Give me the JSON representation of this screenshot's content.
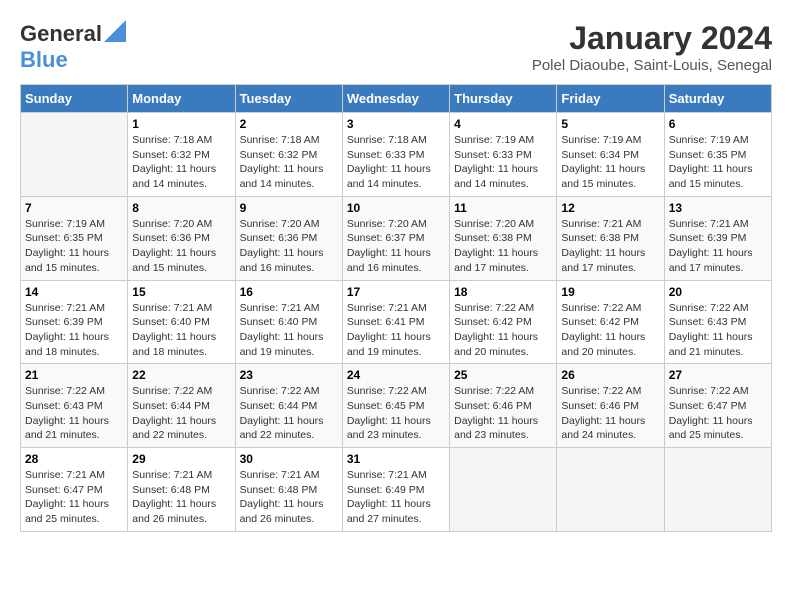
{
  "logo": {
    "general": "General",
    "blue": "Blue"
  },
  "title": "January 2024",
  "subtitle": "Polel Diaoube, Saint-Louis, Senegal",
  "weekdays": [
    "Sunday",
    "Monday",
    "Tuesday",
    "Wednesday",
    "Thursday",
    "Friday",
    "Saturday"
  ],
  "weeks": [
    [
      {
        "day": "",
        "sunrise": "",
        "sunset": "",
        "daylight": ""
      },
      {
        "day": "1",
        "sunrise": "Sunrise: 7:18 AM",
        "sunset": "Sunset: 6:32 PM",
        "daylight": "Daylight: 11 hours and 14 minutes."
      },
      {
        "day": "2",
        "sunrise": "Sunrise: 7:18 AM",
        "sunset": "Sunset: 6:32 PM",
        "daylight": "Daylight: 11 hours and 14 minutes."
      },
      {
        "day": "3",
        "sunrise": "Sunrise: 7:18 AM",
        "sunset": "Sunset: 6:33 PM",
        "daylight": "Daylight: 11 hours and 14 minutes."
      },
      {
        "day": "4",
        "sunrise": "Sunrise: 7:19 AM",
        "sunset": "Sunset: 6:33 PM",
        "daylight": "Daylight: 11 hours and 14 minutes."
      },
      {
        "day": "5",
        "sunrise": "Sunrise: 7:19 AM",
        "sunset": "Sunset: 6:34 PM",
        "daylight": "Daylight: 11 hours and 15 minutes."
      },
      {
        "day": "6",
        "sunrise": "Sunrise: 7:19 AM",
        "sunset": "Sunset: 6:35 PM",
        "daylight": "Daylight: 11 hours and 15 minutes."
      }
    ],
    [
      {
        "day": "7",
        "sunrise": "Sunrise: 7:19 AM",
        "sunset": "Sunset: 6:35 PM",
        "daylight": "Daylight: 11 hours and 15 minutes."
      },
      {
        "day": "8",
        "sunrise": "Sunrise: 7:20 AM",
        "sunset": "Sunset: 6:36 PM",
        "daylight": "Daylight: 11 hours and 15 minutes."
      },
      {
        "day": "9",
        "sunrise": "Sunrise: 7:20 AM",
        "sunset": "Sunset: 6:36 PM",
        "daylight": "Daylight: 11 hours and 16 minutes."
      },
      {
        "day": "10",
        "sunrise": "Sunrise: 7:20 AM",
        "sunset": "Sunset: 6:37 PM",
        "daylight": "Daylight: 11 hours and 16 minutes."
      },
      {
        "day": "11",
        "sunrise": "Sunrise: 7:20 AM",
        "sunset": "Sunset: 6:38 PM",
        "daylight": "Daylight: 11 hours and 17 minutes."
      },
      {
        "day": "12",
        "sunrise": "Sunrise: 7:21 AM",
        "sunset": "Sunset: 6:38 PM",
        "daylight": "Daylight: 11 hours and 17 minutes."
      },
      {
        "day": "13",
        "sunrise": "Sunrise: 7:21 AM",
        "sunset": "Sunset: 6:39 PM",
        "daylight": "Daylight: 11 hours and 17 minutes."
      }
    ],
    [
      {
        "day": "14",
        "sunrise": "Sunrise: 7:21 AM",
        "sunset": "Sunset: 6:39 PM",
        "daylight": "Daylight: 11 hours and 18 minutes."
      },
      {
        "day": "15",
        "sunrise": "Sunrise: 7:21 AM",
        "sunset": "Sunset: 6:40 PM",
        "daylight": "Daylight: 11 hours and 18 minutes."
      },
      {
        "day": "16",
        "sunrise": "Sunrise: 7:21 AM",
        "sunset": "Sunset: 6:40 PM",
        "daylight": "Daylight: 11 hours and 19 minutes."
      },
      {
        "day": "17",
        "sunrise": "Sunrise: 7:21 AM",
        "sunset": "Sunset: 6:41 PM",
        "daylight": "Daylight: 11 hours and 19 minutes."
      },
      {
        "day": "18",
        "sunrise": "Sunrise: 7:22 AM",
        "sunset": "Sunset: 6:42 PM",
        "daylight": "Daylight: 11 hours and 20 minutes."
      },
      {
        "day": "19",
        "sunrise": "Sunrise: 7:22 AM",
        "sunset": "Sunset: 6:42 PM",
        "daylight": "Daylight: 11 hours and 20 minutes."
      },
      {
        "day": "20",
        "sunrise": "Sunrise: 7:22 AM",
        "sunset": "Sunset: 6:43 PM",
        "daylight": "Daylight: 11 hours and 21 minutes."
      }
    ],
    [
      {
        "day": "21",
        "sunrise": "Sunrise: 7:22 AM",
        "sunset": "Sunset: 6:43 PM",
        "daylight": "Daylight: 11 hours and 21 minutes."
      },
      {
        "day": "22",
        "sunrise": "Sunrise: 7:22 AM",
        "sunset": "Sunset: 6:44 PM",
        "daylight": "Daylight: 11 hours and 22 minutes."
      },
      {
        "day": "23",
        "sunrise": "Sunrise: 7:22 AM",
        "sunset": "Sunset: 6:44 PM",
        "daylight": "Daylight: 11 hours and 22 minutes."
      },
      {
        "day": "24",
        "sunrise": "Sunrise: 7:22 AM",
        "sunset": "Sunset: 6:45 PM",
        "daylight": "Daylight: 11 hours and 23 minutes."
      },
      {
        "day": "25",
        "sunrise": "Sunrise: 7:22 AM",
        "sunset": "Sunset: 6:46 PM",
        "daylight": "Daylight: 11 hours and 23 minutes."
      },
      {
        "day": "26",
        "sunrise": "Sunrise: 7:22 AM",
        "sunset": "Sunset: 6:46 PM",
        "daylight": "Daylight: 11 hours and 24 minutes."
      },
      {
        "day": "27",
        "sunrise": "Sunrise: 7:22 AM",
        "sunset": "Sunset: 6:47 PM",
        "daylight": "Daylight: 11 hours and 25 minutes."
      }
    ],
    [
      {
        "day": "28",
        "sunrise": "Sunrise: 7:21 AM",
        "sunset": "Sunset: 6:47 PM",
        "daylight": "Daylight: 11 hours and 25 minutes."
      },
      {
        "day": "29",
        "sunrise": "Sunrise: 7:21 AM",
        "sunset": "Sunset: 6:48 PM",
        "daylight": "Daylight: 11 hours and 26 minutes."
      },
      {
        "day": "30",
        "sunrise": "Sunrise: 7:21 AM",
        "sunset": "Sunset: 6:48 PM",
        "daylight": "Daylight: 11 hours and 26 minutes."
      },
      {
        "day": "31",
        "sunrise": "Sunrise: 7:21 AM",
        "sunset": "Sunset: 6:49 PM",
        "daylight": "Daylight: 11 hours and 27 minutes."
      },
      {
        "day": "",
        "sunrise": "",
        "sunset": "",
        "daylight": ""
      },
      {
        "day": "",
        "sunrise": "",
        "sunset": "",
        "daylight": ""
      },
      {
        "day": "",
        "sunrise": "",
        "sunset": "",
        "daylight": ""
      }
    ]
  ]
}
